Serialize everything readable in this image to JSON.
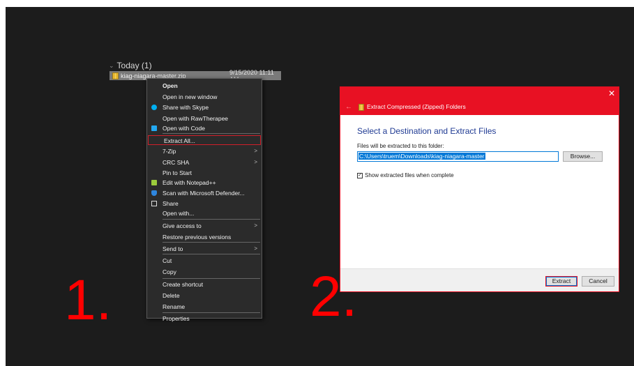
{
  "explorer": {
    "group_header": "Today (1)",
    "file": {
      "name": "kiag-niagara-master.zip",
      "date": "9/15/2020 11:11 AM"
    }
  },
  "context_menu": {
    "items": [
      {
        "label": "Open",
        "icon": "",
        "bold": true
      },
      {
        "label": "Open in new window",
        "icon": ""
      },
      {
        "label": "Share with Skype",
        "icon": "skype-icon",
        "icon_color": "#00aff0"
      },
      {
        "label": "Open with RawTherapee",
        "icon": ""
      },
      {
        "label": "Open with Code",
        "icon": "vscode-icon",
        "icon_color": "#23a9f2"
      },
      {
        "label": "Extract All...",
        "icon": "",
        "highlighted": true
      },
      {
        "label": "7-Zip",
        "icon": "",
        "submenu": true
      },
      {
        "label": "CRC SHA",
        "icon": "",
        "submenu": true
      },
      {
        "label": "Pin to Start",
        "icon": ""
      },
      {
        "label": "Edit with Notepad++",
        "icon": "notepadpp-icon",
        "icon_color": "#9ccc3c"
      },
      {
        "label": "Scan with Microsoft Defender...",
        "icon": "defender-shield-icon",
        "icon_color": "#2e86de"
      },
      {
        "label": "Share",
        "icon": "share-icon",
        "icon_color": "#dddddd"
      },
      {
        "label": "Open with...",
        "icon": ""
      },
      {
        "label": "Give access to",
        "icon": "",
        "submenu": true
      },
      {
        "label": "Restore previous versions",
        "icon": ""
      },
      {
        "label": "Send to",
        "icon": "",
        "submenu": true
      },
      {
        "label": "Cut",
        "icon": ""
      },
      {
        "label": "Copy",
        "icon": ""
      },
      {
        "label": "Create shortcut",
        "icon": ""
      },
      {
        "label": "Delete",
        "icon": ""
      },
      {
        "label": "Rename",
        "icon": ""
      },
      {
        "label": "Properties",
        "icon": ""
      }
    ],
    "submenu_arrow": ">",
    "highlight_color": "#d31f2a"
  },
  "steps": {
    "one": "1.",
    "two": "2.",
    "color": "#ff0000"
  },
  "dialog": {
    "title": "Extract Compressed (Zipped) Folders",
    "back_arrow": "←",
    "close_glyph": "✕",
    "heading": "Select a Destination and Extract Files",
    "path_label": "Files will be extracted to this folder:",
    "path_value": "C:\\Users\\truem\\Downloads\\kiag-niagara-master",
    "browse_label": "Browse...",
    "show_files_label": "Show extracted files when complete",
    "show_files_checked": true,
    "extract_label": "Extract",
    "cancel_label": "Cancel",
    "accent_color": "#e81123"
  }
}
